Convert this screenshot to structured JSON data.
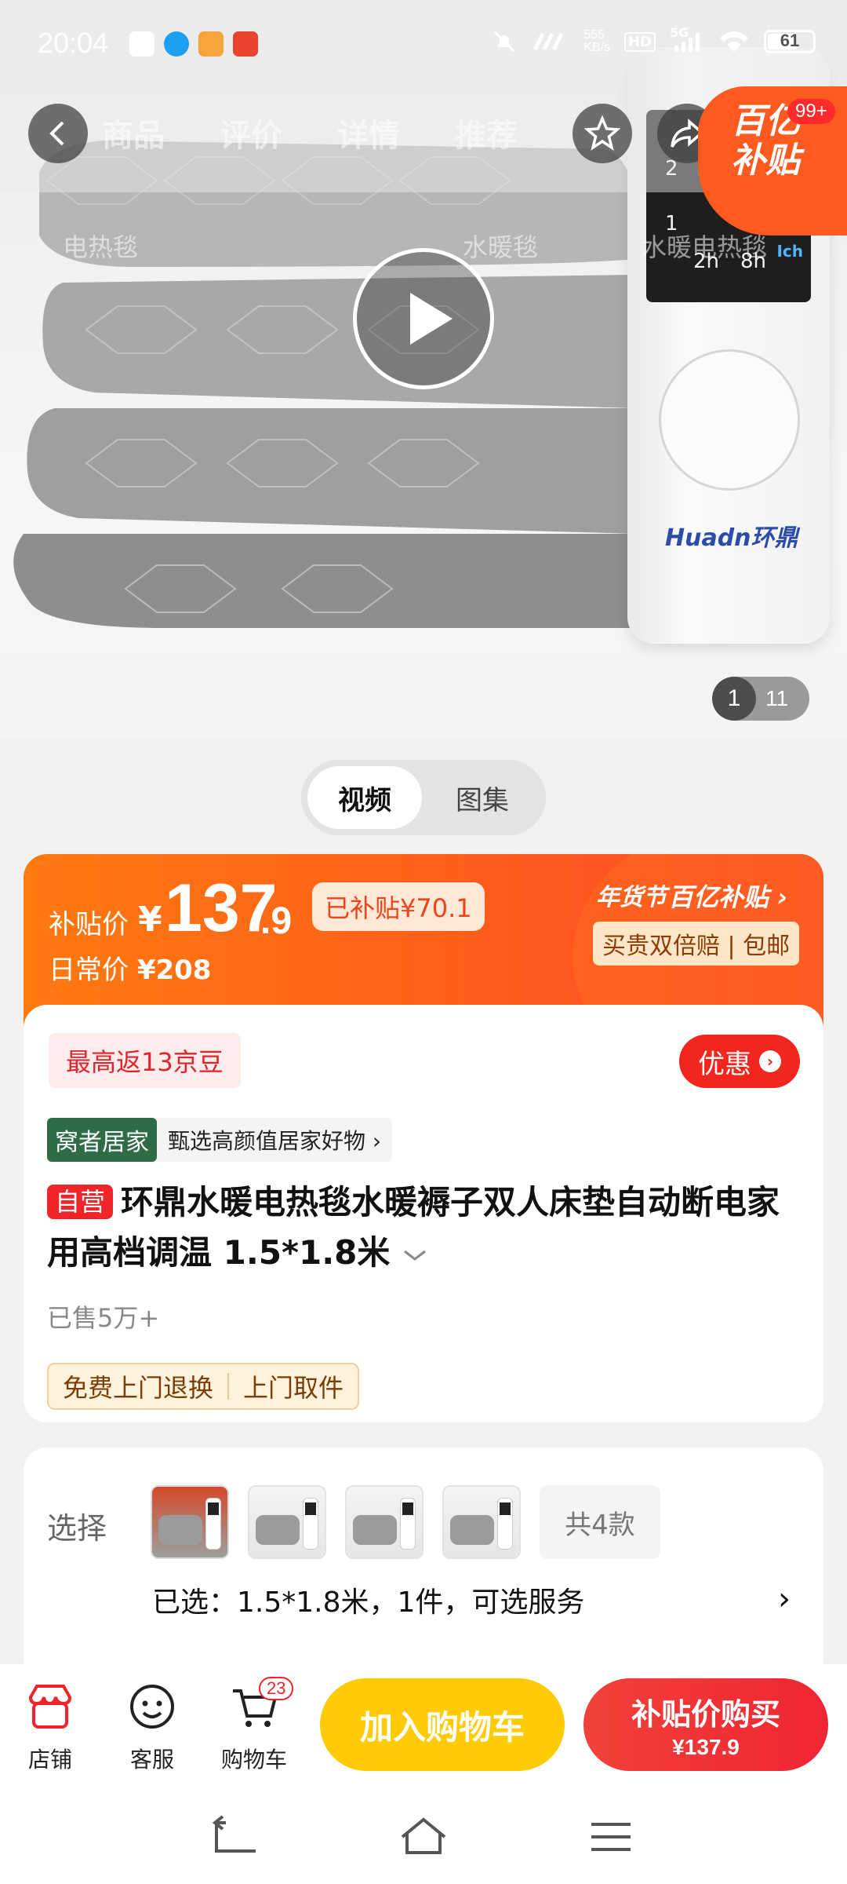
{
  "status_bar": {
    "time": "20:04",
    "network_speed_value": "555",
    "network_speed_unit": "KB/s",
    "hd_label": "HD",
    "signal_label": "5G",
    "battery": "61"
  },
  "top_nav": {
    "tabs": [
      "商品",
      "评价",
      "详情",
      "推荐"
    ],
    "search_hints": [
      "电热毯",
      "水暖毯",
      "水暖电热毯"
    ],
    "subsidy_badge": "百亿补贴",
    "subsidy_badge_line1": "百亿",
    "subsidy_badge_line2": "补贴",
    "notification_count": "99+"
  },
  "hero": {
    "remote_screen": {
      "row1": "2",
      "row2": "1",
      "t1": "2h",
      "t2": "8h",
      "ich": "Ich"
    },
    "remote_brand": "Huadn环鼎",
    "image_index": "1",
    "image_total": "11"
  },
  "media_switch": {
    "video": "视频",
    "gallery": "图集"
  },
  "price": {
    "label": "补贴价",
    "currency": "¥",
    "integer": "137",
    "decimal": ".9",
    "subsidized": "已补贴¥70.1",
    "daily_label": "日常价",
    "daily_price": "¥208",
    "festival": "年货节",
    "subsidy_brand": "百亿补贴",
    "guarantee": "买贵双倍赔 | 包邮"
  },
  "product": {
    "beans": "最高返13京豆",
    "promo_button": "优惠",
    "home_tag": "窝者居家",
    "home_desc": "甄选高颜值居家好物",
    "self_tag": "自营",
    "title": "环鼎水暖电热毯水暖褥子双人床垫自动断电家用高档调温 1.5*1.8米",
    "sold": "已售5万+",
    "services": [
      "免费上门退换",
      "上门取件"
    ]
  },
  "select": {
    "label": "选择",
    "total": "共4款",
    "selected": "已选：1.5*1.8米，1件，可选服务"
  },
  "action_bar": {
    "store": "店铺",
    "service": "客服",
    "cart": "购物车",
    "cart_count": "23",
    "add_to_cart": "加入购物车",
    "buy_label": "补贴价购买",
    "buy_price": "¥137.9"
  },
  "colors": {
    "accent_red": "#f0252a",
    "accent_orange": "#ff6a1d",
    "cart_yellow": "#ffcb05"
  }
}
